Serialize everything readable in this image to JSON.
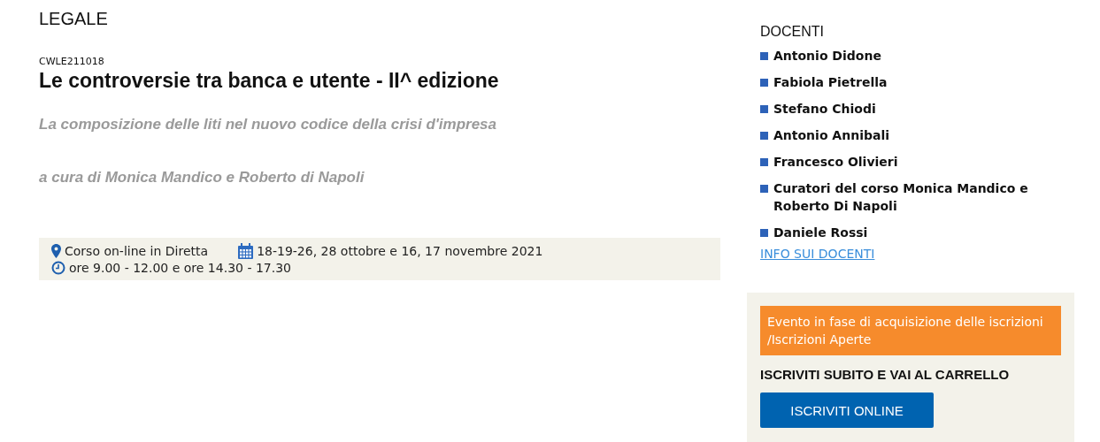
{
  "section": "LEGALE",
  "course": {
    "code": "CWLE211018",
    "title": "Le controversie tra banca e utente - II^ edizione",
    "subtitle": "La composizione delle liti nel nuovo codice della crisi d'impresa",
    "curators": "a cura di Monica Mandico e Roberto di Napoli"
  },
  "info": {
    "location": "Corso on-line in Diretta",
    "dates": "18-19-26, 28 ottobre e 16, 17 novembre 2021",
    "hours": "ore 9.00 - 12.00 e ore 14.30 - 17.30"
  },
  "teachers": {
    "heading": "DOCENTI",
    "items": [
      "Antonio Didone",
      "Fabiola Pietrella",
      "Stefano Chiodi",
      "Antonio Annibali",
      "Francesco Olivieri",
      "Curatori del corso Monica Mandico e Roberto Di Napoli",
      "Daniele Rossi"
    ],
    "link": "INFO SUI DOCENTI"
  },
  "registration": {
    "status": "Evento in fase di acquisizione delle iscrizioni /Iscrizioni Aperte",
    "heading": "ISCRIVITI SUBITO E VAI AL CARRELLO",
    "button": "ISCRIVITI ONLINE"
  }
}
